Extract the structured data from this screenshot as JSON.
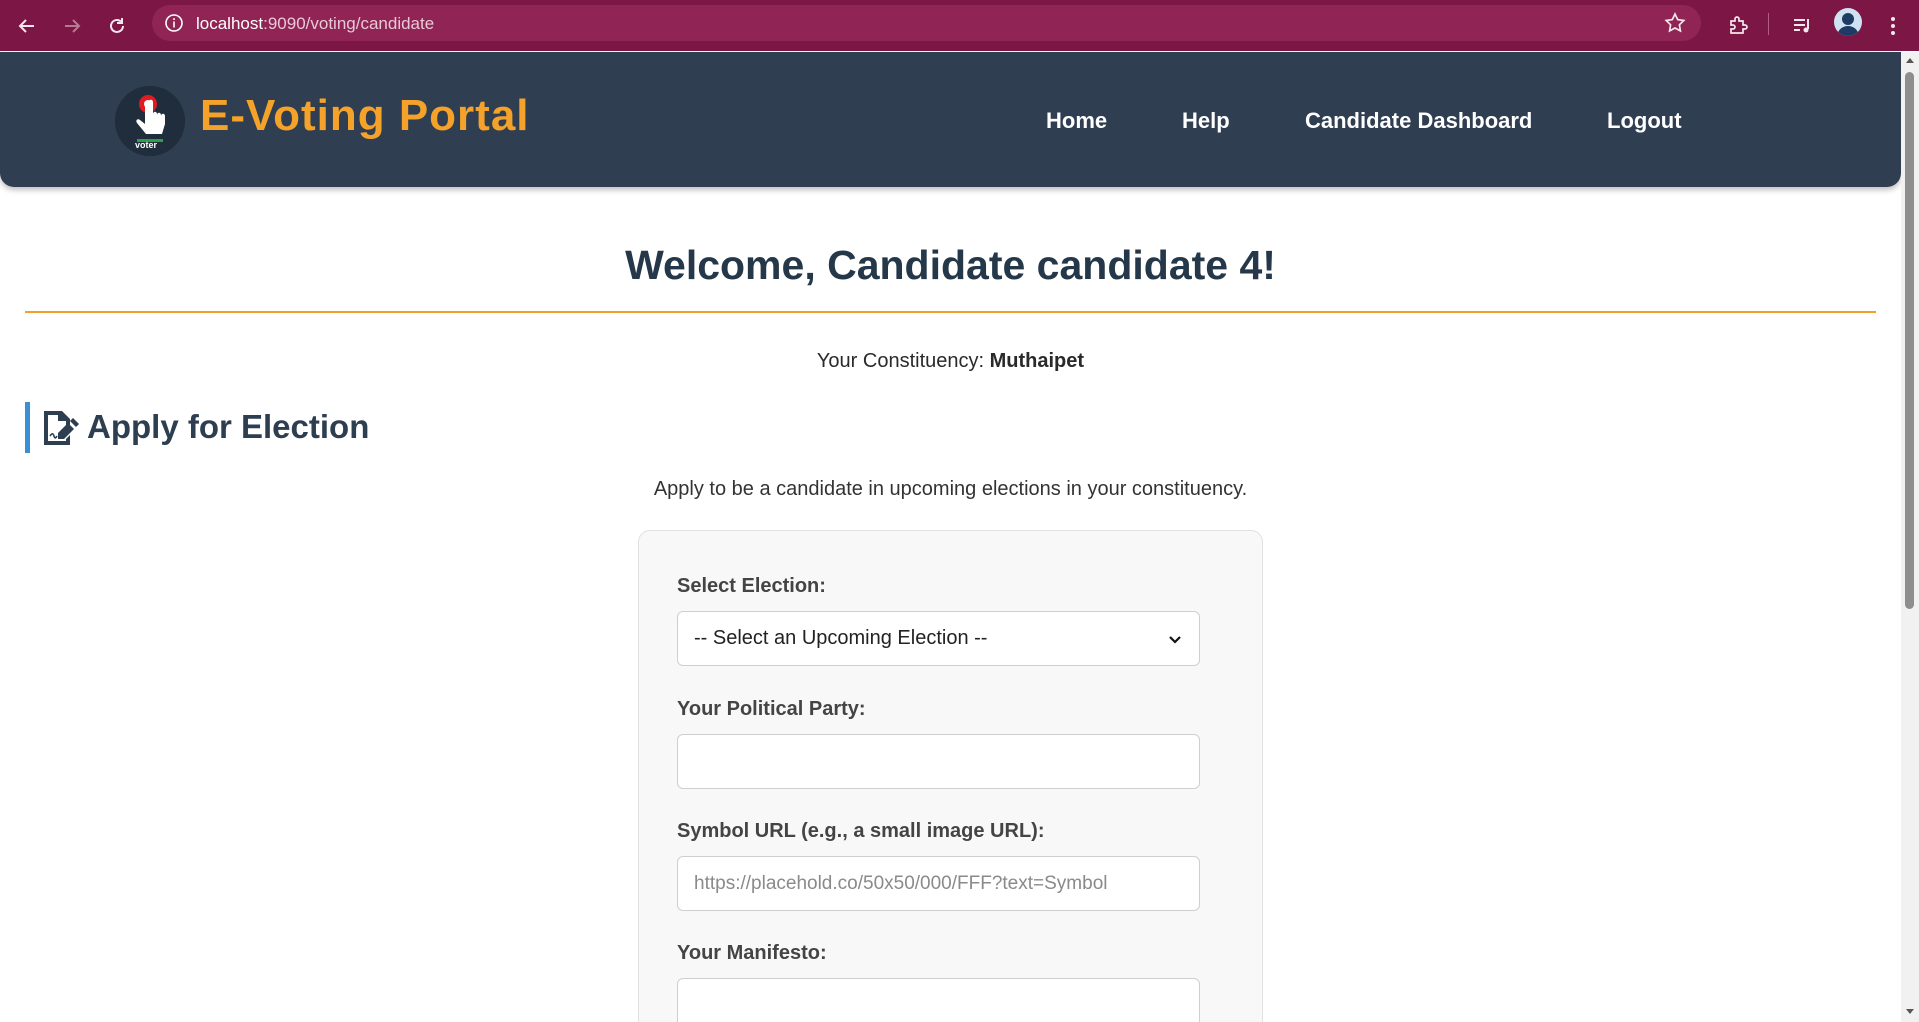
{
  "browser": {
    "url_host": "localhost",
    "url_path": ":9090/voting/candidate"
  },
  "header": {
    "brand": "E-Voting Portal",
    "logo_text": "voter",
    "nav": [
      {
        "label": "Home"
      },
      {
        "label": "Help"
      },
      {
        "label": "Candidate Dashboard"
      },
      {
        "label": "Logout"
      }
    ]
  },
  "main": {
    "welcome": "Welcome, Candidate candidate 4!",
    "constituency_label": "Your Constituency:",
    "constituency_value": "Muthaipet",
    "section_title": "Apply for Election",
    "section_desc": "Apply to be a candidate in upcoming elections in your constituency."
  },
  "form": {
    "election_label": "Select Election:",
    "election_selected": "-- Select an Upcoming Election --",
    "party_label": "Your Political Party:",
    "party_value": "",
    "symbol_label": "Symbol URL (e.g., a small image URL):",
    "symbol_placeholder": "https://placehold.co/50x50/000/FFF?text=Symbol",
    "manifesto_label": "Your Manifesto:"
  },
  "colors": {
    "browser_bar": "#7c1645",
    "header_bg": "#2f3e50",
    "brand_accent": "#f5a22a",
    "section_accent": "#3a8fd6"
  }
}
